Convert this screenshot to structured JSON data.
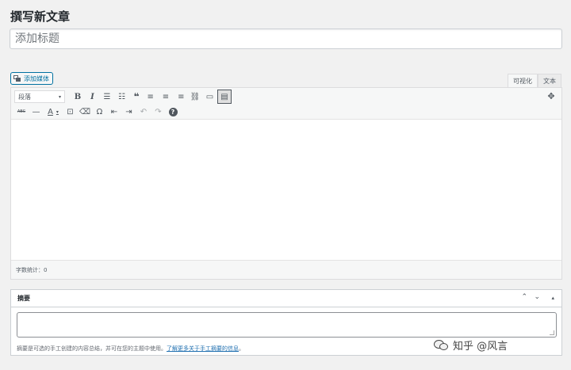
{
  "page": {
    "title": "撰写新文章"
  },
  "title_field": {
    "placeholder": "添加标题"
  },
  "media_button": {
    "label": "添加媒体"
  },
  "editor_tabs": [
    {
      "label": "可视化",
      "active": true
    },
    {
      "label": "文本",
      "active": false
    }
  ],
  "toolbar": {
    "format_select": "段落",
    "row1_icons": [
      "bold-icon",
      "italic-icon",
      "bullet-list-icon",
      "numbered-list-icon",
      "blockquote-icon",
      "align-left-icon",
      "align-center-icon",
      "align-right-icon",
      "link-icon",
      "read-more-icon",
      "toolbar-toggle-icon"
    ],
    "row2_icons": [
      "strikethrough-icon",
      "horizontal-line-icon",
      "text-color-icon",
      "paste-text-icon",
      "clear-formatting-icon",
      "special-character-icon",
      "outdent-icon",
      "indent-icon",
      "undo-icon",
      "redo-icon",
      "help-icon"
    ],
    "glyphs": {
      "bold": "B",
      "italic": "I",
      "ul": "☰",
      "ol": "☷",
      "quote": "❝",
      "left": "≡",
      "center": "≡",
      "right": "≡",
      "link": "⛓",
      "more": "▭",
      "toggle": "▤",
      "strike": "ABC",
      "hr": "—",
      "color": "A",
      "color_caret": "▾",
      "paste": "⊡",
      "clear": "⌫",
      "omega": "Ω",
      "outdent": "⇤",
      "indent": "⇥",
      "undo": "↶",
      "redo": "↷",
      "help": "?",
      "expand": "✥",
      "caret": "▾",
      "chev_up": "⌃",
      "chev_down": "⌄",
      "toggle_arrow": "▴"
    }
  },
  "status_bar": {
    "word_count": "字数统计：0"
  },
  "excerpt": {
    "title": "摘要",
    "help_text": "摘要是可选的手工创建的内容总结，并可在您的主题中使用。",
    "help_link": "了解更多关于手工摘要的信息",
    "help_end": "。"
  },
  "watermark": {
    "text": "知乎 @风言"
  },
  "colors": {
    "accent": "#0071a1",
    "background": "#f1f1f1",
    "border": "#ccd0d4"
  }
}
